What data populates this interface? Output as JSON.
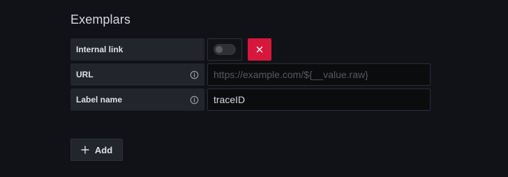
{
  "section": {
    "title": "Exemplars"
  },
  "rows": [
    {
      "label": "Internal link",
      "type": "toggle",
      "toggle_on": false
    },
    {
      "label": "URL",
      "type": "input",
      "value": "",
      "placeholder": "https://example.com/${__value.raw}"
    },
    {
      "label": "Label name",
      "type": "input",
      "value": "traceID",
      "placeholder": ""
    }
  ],
  "add_button": {
    "label": "Add"
  },
  "icons": {
    "info": "info-circle-icon",
    "remove": "times-icon",
    "add": "plus-icon"
  },
  "colors": {
    "background": "#111217",
    "label_bg": "#22252b",
    "danger": "#d7183c",
    "input_bg": "#0b0c0e"
  }
}
